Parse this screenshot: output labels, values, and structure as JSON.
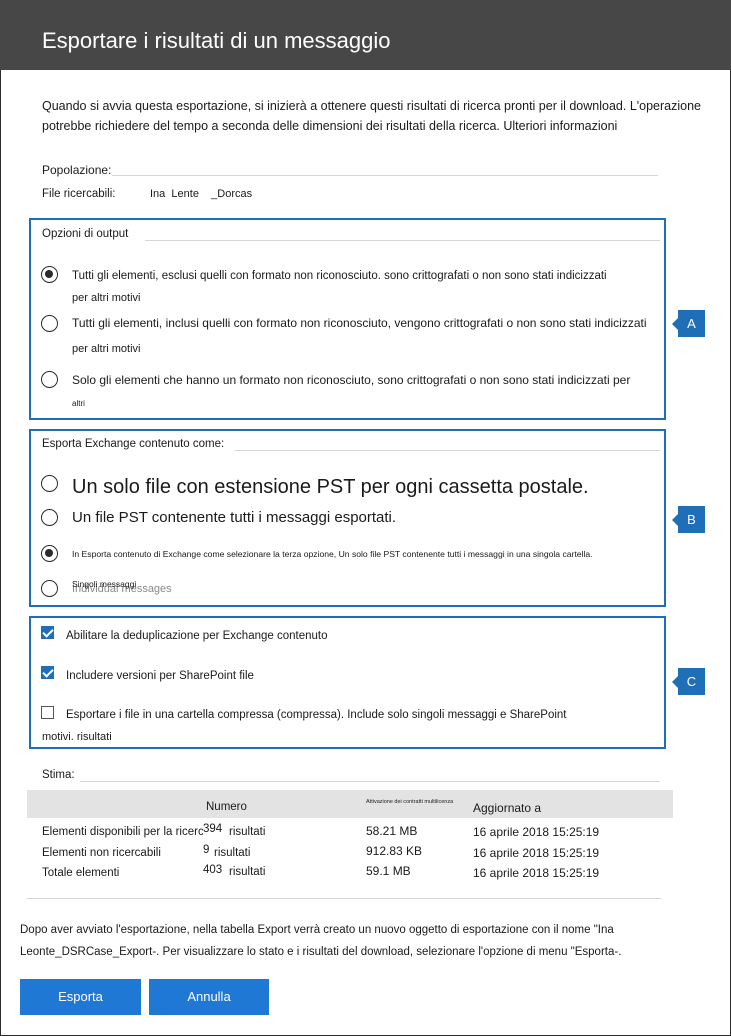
{
  "dialog": {
    "title": "Esportare i risultati di un messaggio"
  },
  "intro_line1": "Quando si avvia questa esportazione, si inizierà a ottenere questi risultati di ricerca pronti per il download. L'operazione",
  "intro_line2": "potrebbe richiedere del tempo a seconda delle dimensioni dei risultati della ricerca. Ulteriori informazioni",
  "fields": {
    "population_label": "Popolazione:",
    "searchable_label": "File ricercabili:",
    "searchable_value": "Ina  Lente    _Dorcas"
  },
  "output_options": {
    "label": "Opzioni di output",
    "tag": "A",
    "items": [
      {
        "line1": "Tutti gli elementi, esclusi quelli con formato non riconosciuto. sono crittografati o non sono stati indicizzati",
        "line2": "per altri motivi",
        "selected": true
      },
      {
        "line1": "Tutti gli elementi, inclusi quelli con formato non riconosciuto, vengono crittografati o non sono stati indicizzati",
        "line2": "per altri motivi",
        "selected": false
      },
      {
        "line1": "Solo gli elementi che hanno un formato non riconosciuto, sono crittografati o non sono stati indicizzati per",
        "line2": "altri",
        "selected": false
      }
    ]
  },
  "exchange_export": {
    "label": "Esporta Exchange contenuto come:",
    "tag": "B",
    "items": [
      {
        "text": "Un solo file con estensione PST per ogni cassetta postale.",
        "selected": false
      },
      {
        "text": "Un file PST contenente tutti i messaggi esportati.",
        "selected": false
      },
      {
        "text": "In Esporta contenuto di Exchange come selezionare la terza opzione, Un solo file PST contenente tutti i messaggi in una singola cartella.",
        "selected": true
      },
      {
        "text": "Singoli messaggi",
        "ghost": "Individual messages",
        "selected": false
      }
    ]
  },
  "checkboxes": {
    "tag": "C",
    "items": [
      {
        "text": "Abilitare la deduplicazione per Exchange contenuto",
        "checked": true
      },
      {
        "text": "Includere versioni per SharePoint file",
        "checked": true
      },
      {
        "text": "Esportare i file in una cartella compressa (compressa). Include solo singoli messaggi e SharePoint",
        "text2": "motivi. risultati",
        "checked": false
      }
    ]
  },
  "estimate": {
    "label": "Stima:",
    "headers": {
      "number": "Numero",
      "size": "Attivazione dei contratti multilicenza",
      "updated": "Aggiornato a"
    },
    "rows": [
      {
        "label": "Elementi disponibili per la ricerca",
        "count": "394",
        "unit": "risultati",
        "size": "58.21 MB",
        "date": "16 aprile 2018 15:25:19"
      },
      {
        "label": "Elementi non ricercabili",
        "count": "9",
        "unit": "risultati",
        "size": "912.83 KB",
        "date": "16 aprile 2018 15:25:19"
      },
      {
        "label": "Totale elementi",
        "count": "403",
        "unit": "risultati",
        "size": "59.1 MB",
        "date": "16 aprile 2018 15:25:19"
      }
    ]
  },
  "footer_line1": "Dopo aver avviato l'esportazione, nella tabella Export verrà creato un nuovo oggetto di esportazione con il nome \"Ina",
  "footer_line2": "Leonte_DSRCase_Export-. Per visualizzare lo stato e i risultati del download, selezionare l'opzione di menu \"Esporta-.",
  "buttons": {
    "export": "Esporta",
    "cancel": "Annulla"
  },
  "colors": {
    "header": "#474747",
    "accent": "#1e6fb8",
    "button": "#1e78d4"
  }
}
